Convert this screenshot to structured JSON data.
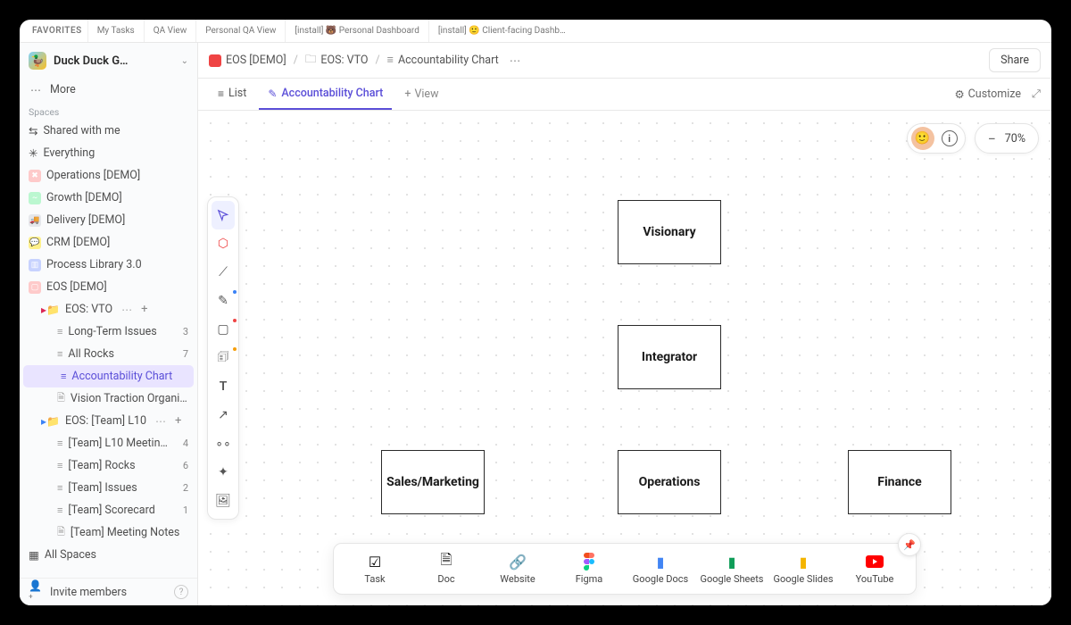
{
  "favorites": {
    "label": "FAVORITES",
    "items": [
      "My Tasks",
      "QA View",
      "Personal QA View",
      "[install] 🐻 Personal Dashboard",
      "[install] 🙂 Client-facing Dashb…"
    ]
  },
  "workspace": {
    "name": "Duck Duck G…",
    "icon": "🦆"
  },
  "sidebar": {
    "more": "More",
    "spaces_label": "Spaces",
    "shared": "Shared with me",
    "everything": "Everything",
    "spaces": [
      {
        "label": "Operations [DEMO]",
        "color": "ops",
        "glyph": "✖"
      },
      {
        "label": "Growth [DEMO]",
        "color": "growth",
        "glyph": "📈"
      },
      {
        "label": "Delivery [DEMO]",
        "color": "del",
        "glyph": "🚚"
      },
      {
        "label": "CRM [DEMO]",
        "color": "crm",
        "glyph": "💬"
      },
      {
        "label": "Process Library 3.0",
        "color": "proc",
        "glyph": "📚"
      },
      {
        "label": "EOS [DEMO]",
        "color": "eos",
        "glyph": "🖥"
      }
    ],
    "eos_vto": {
      "label": "EOS: VTO",
      "items": [
        {
          "label": "Long-Term Issues",
          "count": "3"
        },
        {
          "label": "All Rocks",
          "count": "7"
        },
        {
          "label": "Accountability Chart",
          "selected": true
        },
        {
          "label": "Vision Traction Organi…",
          "doc": true
        }
      ]
    },
    "eos_team": {
      "label": "EOS: [Team] L10",
      "items": [
        {
          "label": "[Team] L10 Meetin…",
          "count": "4"
        },
        {
          "label": "[Team] Rocks",
          "count": "6"
        },
        {
          "label": "[Team] Issues",
          "count": "2"
        },
        {
          "label": "[Team] Scorecard",
          "count": "1"
        },
        {
          "label": "[Team] Meeting Notes",
          "doc": true
        }
      ]
    },
    "all_spaces": "All Spaces",
    "invite": "Invite members"
  },
  "breadcrumb": {
    "a": "EOS [DEMO]",
    "b": "EOS: VTO",
    "c": "Accountability Chart",
    "share": "Share"
  },
  "views": {
    "list": "List",
    "chart": "Accountability Chart",
    "add": "View",
    "customize": "Customize"
  },
  "zoom": "70%",
  "org": {
    "n1": "Visionary",
    "n2": "Integrator",
    "n3": "Sales/Marketing",
    "n4": "Operations",
    "n5": "Finance"
  },
  "insert": {
    "items": [
      {
        "label": "Task",
        "icon": "✓"
      },
      {
        "label": "Doc",
        "icon": "📄"
      },
      {
        "label": "Website",
        "icon": "🔗"
      },
      {
        "label": "Figma",
        "icon": "🎨",
        "color": "#f24e1e"
      },
      {
        "label": "Google Docs",
        "icon": "📘",
        "color": "#4285f4"
      },
      {
        "label": "Google Sheets",
        "icon": "📗",
        "color": "#0f9d58"
      },
      {
        "label": "Google Slides",
        "icon": "📙",
        "color": "#f4b400"
      },
      {
        "label": "YouTube",
        "icon": "▶",
        "color": "#ff0000"
      }
    ]
  }
}
